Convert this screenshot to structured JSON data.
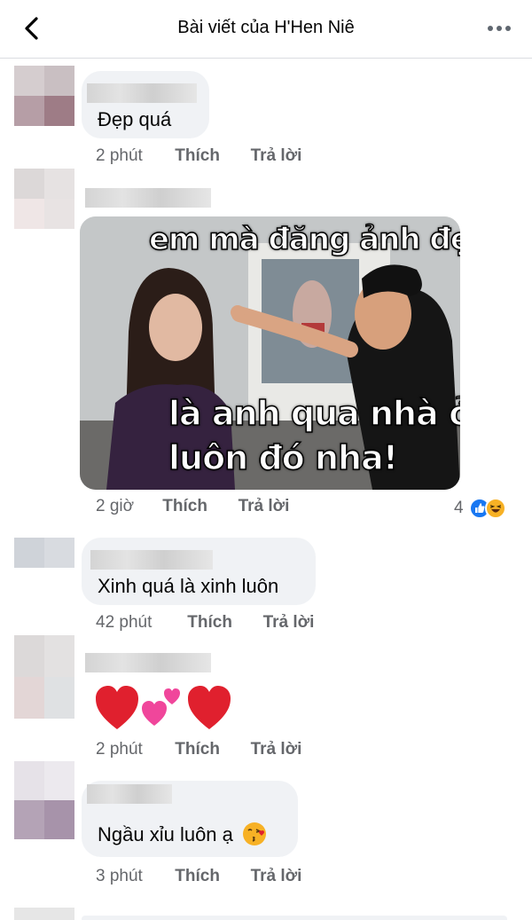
{
  "header": {
    "title": "Bài viết của H'Hen Niê",
    "back_icon": "chevron-left-icon",
    "more_icon": "more-dots-icon"
  },
  "action_labels": {
    "like": "Thích",
    "reply": "Trả lời"
  },
  "comments": [
    {
      "text": "Đẹp quá",
      "time": "2 phút"
    },
    {
      "image_meme": {
        "caption_top": "em mà đăng ảnh đẹp nữa",
        "caption_bottom_1": "là anh qua nhà ở",
        "caption_bottom_2": "luôn đó nha!"
      },
      "time": "2 giờ",
      "reaction_count": "4",
      "reaction_icons": [
        "like-reaction-icon",
        "haha-reaction-icon"
      ]
    },
    {
      "text": "Xinh quá là xinh luôn",
      "time": "42 phút"
    },
    {
      "emoji_icons": [
        "red-heart-icon",
        "two-hearts-icon",
        "red-heart-icon"
      ],
      "time": "2 phút"
    },
    {
      "text": "Ngầu xỉu luôn ạ",
      "emoji_icon": "kissing-face-icon",
      "time": "3 phút"
    }
  ],
  "colors": {
    "bubble": "#f0f2f5",
    "meta_text": "#65676b",
    "like_blue": "#1877f2",
    "haha_yellow": "#f7b125",
    "heart_red": "#e0202e",
    "pink_heart": "#f0469b"
  }
}
